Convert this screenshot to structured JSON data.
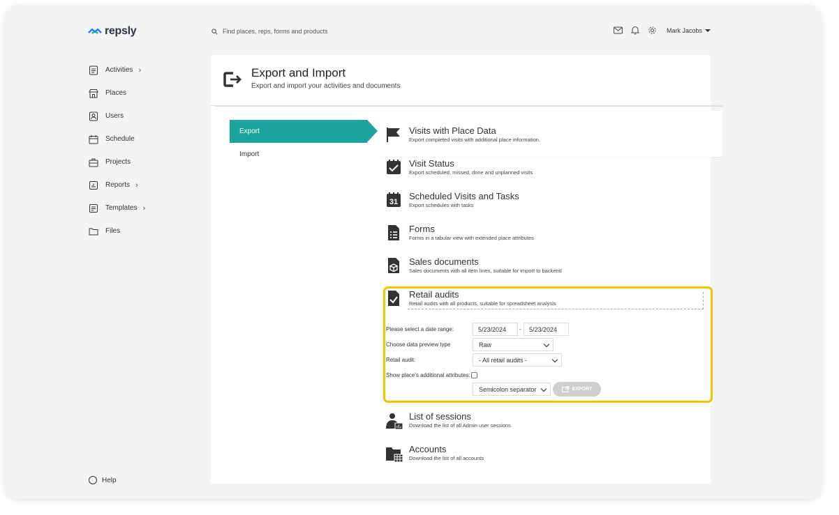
{
  "app": {
    "logo_text": "repsly"
  },
  "search": {
    "placeholder": "Find places, reps, forms and products"
  },
  "user": {
    "name": "Mark Jacobs"
  },
  "sidebar": {
    "items": [
      {
        "label": "Activities",
        "icon": "activities-icon",
        "chevron": "›"
      },
      {
        "label": "Places",
        "icon": "store-icon",
        "chevron": ""
      },
      {
        "label": "Users",
        "icon": "user-badge-icon",
        "chevron": ""
      },
      {
        "label": "Schedule",
        "icon": "calendar-icon",
        "chevron": ""
      },
      {
        "label": "Projects",
        "icon": "briefcase-icon",
        "chevron": ""
      },
      {
        "label": "Reports",
        "icon": "reports-icon",
        "chevron": "›"
      },
      {
        "label": "Templates",
        "icon": "templates-icon",
        "chevron": "›"
      },
      {
        "label": "Files",
        "icon": "folder-icon",
        "chevron": ""
      }
    ],
    "help_label": "Help"
  },
  "page": {
    "title": "Export and Import",
    "subtitle": "Export and import your activities and documents"
  },
  "tabs": {
    "export_label": "Export",
    "import_label": "Import"
  },
  "items": {
    "visits": {
      "title": "Visits with Place Data",
      "desc": "Export completed visits with additional place information."
    },
    "status": {
      "title": "Visit Status",
      "desc": "Export scheduled, missed, done and unplanned visits"
    },
    "scheduled": {
      "title": "Scheduled Visits and Tasks",
      "desc": "Export schedules with tasks",
      "icon_number": "31"
    },
    "forms": {
      "title": "Forms",
      "desc": "Forms in a tabular view with extended place attributes"
    },
    "sales": {
      "title": "Sales documents",
      "desc": "Sales documents with all item lines, suitable for import to backend"
    },
    "audits": {
      "title": "Retail audits",
      "desc": "Retail audits with all products, suitable for spreadsheet analysis"
    },
    "sessions": {
      "title": "List of sessions",
      "desc": "Download the list of all Admin user sessions"
    },
    "accounts": {
      "title": "Accounts",
      "desc": "Download the list of all accounts"
    }
  },
  "audit_form": {
    "date_range_label": "Please select a date range:",
    "date_from": "5/23/2024",
    "date_separator": "-",
    "date_to": "5/23/2024",
    "preview_type_label": "Choose data preview type",
    "preview_type_value": "Raw",
    "retail_audit_label": "Retail audit:",
    "retail_audit_value": "- All retail audits -",
    "additional_attrs_label": "Show place's additional attributes:",
    "separator_value": "Semicolon separator",
    "export_button": "EXPORT"
  },
  "colors": {
    "accent": "#1ba39c",
    "highlight": "#f5c400",
    "logo_blue": "#2b7be4",
    "logo_teal": "#19b3a3"
  }
}
